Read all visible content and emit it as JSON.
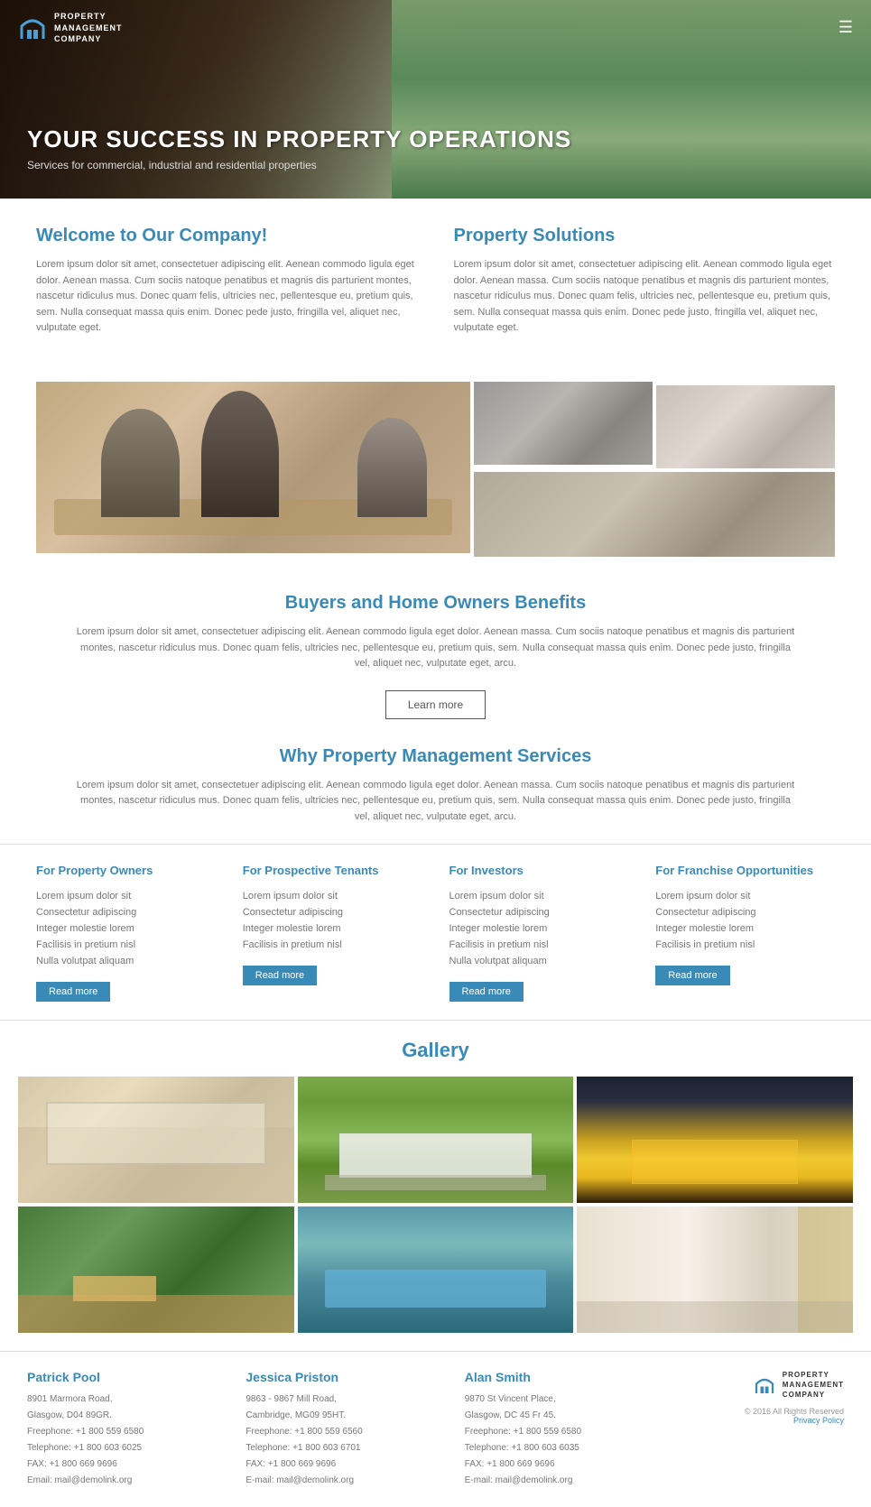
{
  "header": {
    "logo_line1": "PROPERTY",
    "logo_line2": "MANAGEMENT",
    "logo_line3": "COMPANY",
    "title": "YOUR SUCCESS IN PROPERTY OPERATIONS",
    "subtitle": "Services for commercial, industrial and residential properties"
  },
  "welcome": {
    "title": "Welcome to Our Company!",
    "text": "Lorem ipsum dolor sit amet, consectetuer adipiscing elit. Aenean commodo ligula eget dolor. Aenean massa. Cum sociis natoque penatibus et magnis dis parturient montes, nascetur ridiculus mus. Donec quam felis, ultricies nec, pellentesque eu, pretium quis, sem. Nulla consequat massa quis enim. Donec pede justo, fringilla vel, aliquet nec, vulputate eget."
  },
  "property_solutions": {
    "title": "Property Solutions",
    "text": "Lorem ipsum dolor sit amet, consectetuer adipiscing elit. Aenean commodo ligula eget dolor. Aenean massa. Cum sociis natoque penatibus et magnis dis parturient montes, nascetur ridiculus mus. Donec quam felis, ultricies nec, pellentesque eu, pretium quis, sem. Nulla consequat massa quis enim. Donec pede justo, fringilla vel, aliquet nec, vulputate eget."
  },
  "buyers": {
    "title": "Buyers and Home Owners Benefits",
    "text": "Lorem ipsum dolor sit amet, consectetuer adipiscing elit. Aenean commodo ligula eget dolor. Aenean massa. Cum sociis natoque penatibus et magnis dis parturient montes, nascetur ridiculus mus. Donec quam felis, ultricies nec, pellentesque eu, pretium quis, sem. Nulla consequat massa quis enim. Donec pede justo, fringilla vel, aliquet nec, vulputate eget, arcu.",
    "learn_more": "Learn more"
  },
  "why": {
    "title": "Why Property Management Services",
    "text": "Lorem ipsum dolor sit amet, consectetuer adipiscing elit. Aenean commodo ligula eget dolor. Aenean massa. Cum sociis natoque penatibus et magnis dis parturient montes, nascetur ridiculus mus. Donec quam felis, ultricies nec, pellentesque eu, pretium quis, sem. Nulla consequat massa quis enim. Donec pede justo, fringilla vel, aliquet nec, vulputate eget, arcu."
  },
  "services": [
    {
      "title": "For Property Owners",
      "items": [
        "Lorem ipsum dolor sit",
        "Consectetur adipiscing",
        "Integer molestie lorem",
        "Facilisis in pretium nisl",
        "Nulla volutpat aliquam"
      ],
      "btn": "Read more"
    },
    {
      "title": "For Prospective Tenants",
      "items": [
        "Lorem ipsum dolor sit",
        "Consectetur adipiscing",
        "Integer molestie lorem",
        "Facilisis in pretium nisl"
      ],
      "btn": "Read more"
    },
    {
      "title": "For Investors",
      "items": [
        "Lorem ipsum dolor sit",
        "Consectetur adipiscing",
        "Integer molestie lorem",
        "Facilisis in pretium nisl",
        "Nulla volutpat aliquam"
      ],
      "btn": "Read more"
    },
    {
      "title": "For Franchise Opportunities",
      "items": [
        "Lorem ipsum dolor sit",
        "Consectetur adipiscing",
        "Integer molestie lorem",
        "Facilisis in pretium nisl"
      ],
      "btn": "Read more"
    }
  ],
  "gallery": {
    "title": "Gallery"
  },
  "footer": {
    "contacts": [
      {
        "name": "Patrick Pool",
        "address": "8901 Marmora Road,\nGlasgow, D04 89GR.",
        "freephone": "Freephone: +1 800 559 6580",
        "telephone": "Telephone: +1 800 603 6025",
        "fax": "FAX: +1 800 669 9696",
        "email": "Email: mail@demolink.org"
      },
      {
        "name": "Jessica Priston",
        "address": "9863 - 9867 Mill Road,\nCambridge, MG09 95HT.",
        "freephone": "Freephone: +1 800 559 6560",
        "telephone": "Telephone: +1 800 603 6701",
        "fax": "FAX: +1 800 669 9696",
        "email": "E-mail: mail@demolink.org"
      },
      {
        "name": "Alan Smith",
        "address": "9870 St Vincent Place,\nGlasgow, DC 45 Fr 45.",
        "freephone": "Freephone: +1 800 559 6580",
        "telephone": "Telephone: +1 800 603 6035",
        "fax": "FAX: +1 800 669 9696",
        "email": "E-mail: mail@demolink.org"
      }
    ],
    "logo_line1": "PROPERTY",
    "logo_line2": "MANAGEMENT",
    "logo_line3": "COMPANY",
    "copyright": "© 2016 All Rights Reserved",
    "privacy": "Privacy Policy"
  }
}
